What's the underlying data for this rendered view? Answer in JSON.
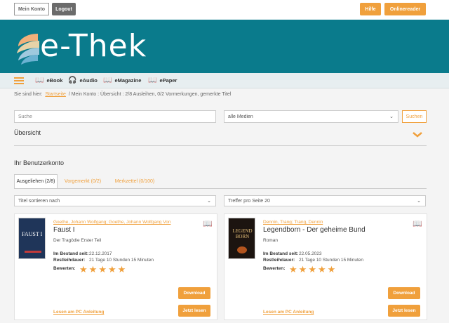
{
  "topbar": {
    "mein_konto": "Mein Konto",
    "logout": "Logout",
    "hilfe": "Hilfe",
    "onlinereader": "Onlinereader"
  },
  "brand": {
    "logo_text": "e-Thek",
    "banner_color": "#0a7b8c",
    "accent_color": "#f0a03c"
  },
  "nav": {
    "menu_icon": "hamburger-icon",
    "items": [
      {
        "label": "eBook",
        "icon": "open-book-icon"
      },
      {
        "label": "eAudio",
        "icon": "headphones-icon"
      },
      {
        "label": "eMagazine",
        "icon": "open-book-icon"
      },
      {
        "label": "ePaper",
        "icon": "open-book-icon"
      }
    ]
  },
  "breadcrumb": {
    "prefix": "Sie sind hier:",
    "home": "Startseite",
    "rest": "/  Mein Konto : Übersicht : 2/8 Ausleihen, 0/2 Vormerkungen, gemerkte Titel"
  },
  "search": {
    "placeholder": "Suche",
    "media_select": "alle Medien",
    "button": "Suchen"
  },
  "sections": {
    "uebersicht": "Übersicht",
    "benutzerkonto": "Ihr Benutzerkonto"
  },
  "tabs": [
    {
      "label": "Ausgeliehen (2/8)",
      "active": true
    },
    {
      "label": "Vorgemerkt (0/2)",
      "active": false
    },
    {
      "label": "Merkzettel (0/100)",
      "active": false
    }
  ],
  "sort": {
    "label": "Titel sortieren nach",
    "per_page": "Treffer pro Seite 20"
  },
  "labels": {
    "bestand": "Im Bestand seit:",
    "leihdauer": "Restleihdauer:",
    "bewerten": "Bewerten:",
    "download": "Download",
    "jetzt_lesen": "Jetzt lesen",
    "pc_anleitung": "Lesen am PC Anleitung"
  },
  "books": [
    {
      "author": "Goethe, Johann Wolfgang; Goethe, Johann Wolfgang Von",
      "title": "Faust I",
      "subtitle": "Der Tragödie Erster Teil",
      "bestand": "22.12.2017",
      "leihdauer": "21 Tage 10 Stunden 15 Minuten",
      "rating_stars": 5,
      "cover_text": "FAUST I"
    },
    {
      "author": "Dennin, Trang; Trang, Dennin",
      "title": "Legendborn - Der geheime Bund",
      "subtitle": "Roman",
      "bestand": "22.05.2023",
      "leihdauer": "21 Tage 10 Stunden 15 Minuten",
      "rating_stars": 5,
      "cover_text": "LEGEND BORN"
    }
  ]
}
